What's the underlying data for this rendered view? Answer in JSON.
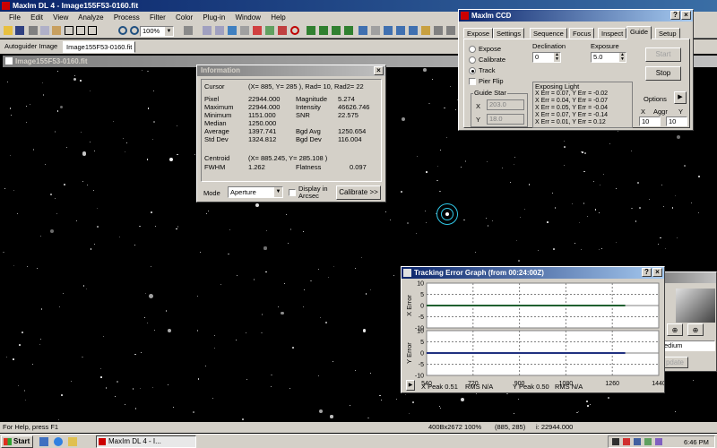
{
  "app": {
    "title": "MaxIm DL 4 - Image155F53-0160.fit"
  },
  "menu": [
    "File",
    "Edit",
    "View",
    "Analyze",
    "Process",
    "Filter",
    "Color",
    "Plug-in",
    "Window",
    "Help"
  ],
  "toolbar": {
    "zoom": "100%"
  },
  "doc_tabs": [
    "Autoguider Image",
    "Image155F53-0160.fit"
  ],
  "image_window": {
    "title": "Image155F53-0160.fit"
  },
  "info": {
    "title": "Information",
    "cursor_label": "Cursor",
    "cursor_value": "(X= 885, Y= 285 ), Rad= 10, Rad2= 22",
    "rows": [
      {
        "l1": "Pixel",
        "v1": "22944.000",
        "l2": "Magnitude",
        "v2": "5.274"
      },
      {
        "l1": "Maximum",
        "v1": "22944.000",
        "l2": "Intensity",
        "v2": "46626.746"
      },
      {
        "l1": "Minimum",
        "v1": "1151.000",
        "l2": "SNR",
        "v2": "22.575"
      },
      {
        "l1": "Median",
        "v1": "1250.000",
        "l2": "",
        "v2": ""
      },
      {
        "l1": "Average",
        "v1": "1397.741",
        "l2": "Bgd Avg",
        "v2": "1250.654"
      },
      {
        "l1": "Std Dev",
        "v1": "1324.812",
        "l2": "Bgd Dev",
        "v2": "116.004"
      }
    ],
    "centroid_label": "Centroid",
    "centroid_value": "(X= 885.245, Y= 285.108 )",
    "fwhm_label": "FWHM",
    "fwhm_value": "1.262",
    "flatness_label": "Flatness",
    "flatness_value": "0.097",
    "mode_label": "Mode",
    "mode_value": "Aperture",
    "arcsec_label": "Display in Arcsec",
    "calibrate": "Calibrate >>"
  },
  "ccd": {
    "title": "MaxIm CCD",
    "tabs": [
      "Expose",
      "Settings",
      "Sequence",
      "Focus",
      "Inspect",
      "Guide",
      "Setup"
    ],
    "active_tab": "Guide",
    "radios": [
      "Expose",
      "Calibrate",
      "Track"
    ],
    "selected_radio": "Track",
    "pierflip": "Pier Flip",
    "declination_label": "Declination",
    "declination_value": "0",
    "exposure_label": "Exposure",
    "exposure_value": "5.0",
    "start": "Start",
    "stop": "Stop",
    "guidestar_label": "Guide Star",
    "gs_x_label": "X",
    "gs_x": "203.0",
    "gs_y_label": "Y",
    "gs_y": "18.0",
    "status_title": "Exposing Light",
    "status_lines": [
      "X Err = 0.07, Y Err = -0.02",
      "X Err = 0.04, Y Err = -0.07",
      "X Err = 0.05, Y Err = -0.04",
      "X Err = 0.07, Y Err = -0.14",
      "X Err = 0.01, Y Err = 0.12"
    ],
    "options": "Options",
    "x_label": "X",
    "aggr_label": "Aggr",
    "y_label": "Y",
    "aggr_x": "10",
    "aggr_y": "10"
  },
  "tracking": {
    "title": "Tracking Error Graph (from 00:24:00Z)",
    "xerr_label": "X Error",
    "yerr_label": "Y Error",
    "yticks": [
      "10",
      "5",
      "0",
      "-5",
      "-10"
    ],
    "xticks": [
      "540",
      "720",
      "900",
      "1080",
      "1260",
      "1440"
    ],
    "xpeak": "X Peak 0.51",
    "rms_x": "RMS N/A",
    "ypeak": "Y Peak 0.50",
    "rms_y": "RMS N/A"
  },
  "behind": {
    "medium": "edium",
    "update": "pdate"
  },
  "status": {
    "help": "For Help, press F1",
    "dims": "400Bx2672 100%",
    "coords": "(885, 285)",
    "value": "i: 22944.000"
  },
  "taskbar": {
    "start": "Start",
    "task": "MaxIm DL 4 - I...",
    "time": "6:46 PM"
  },
  "chart_data": {
    "type": "line",
    "title": "Tracking Error Graph (from 00:24:00Z)",
    "x": [
      540,
      720,
      900,
      1080,
      1260,
      1310
    ],
    "xlim": [
      540,
      1440
    ],
    "ylim": [
      -10,
      10
    ],
    "series": [
      {
        "name": "X Error",
        "values": [
          0,
          0,
          0,
          0,
          0,
          0
        ]
      },
      {
        "name": "Y Error",
        "values": [
          0,
          0,
          0,
          0,
          0,
          0
        ]
      }
    ]
  }
}
